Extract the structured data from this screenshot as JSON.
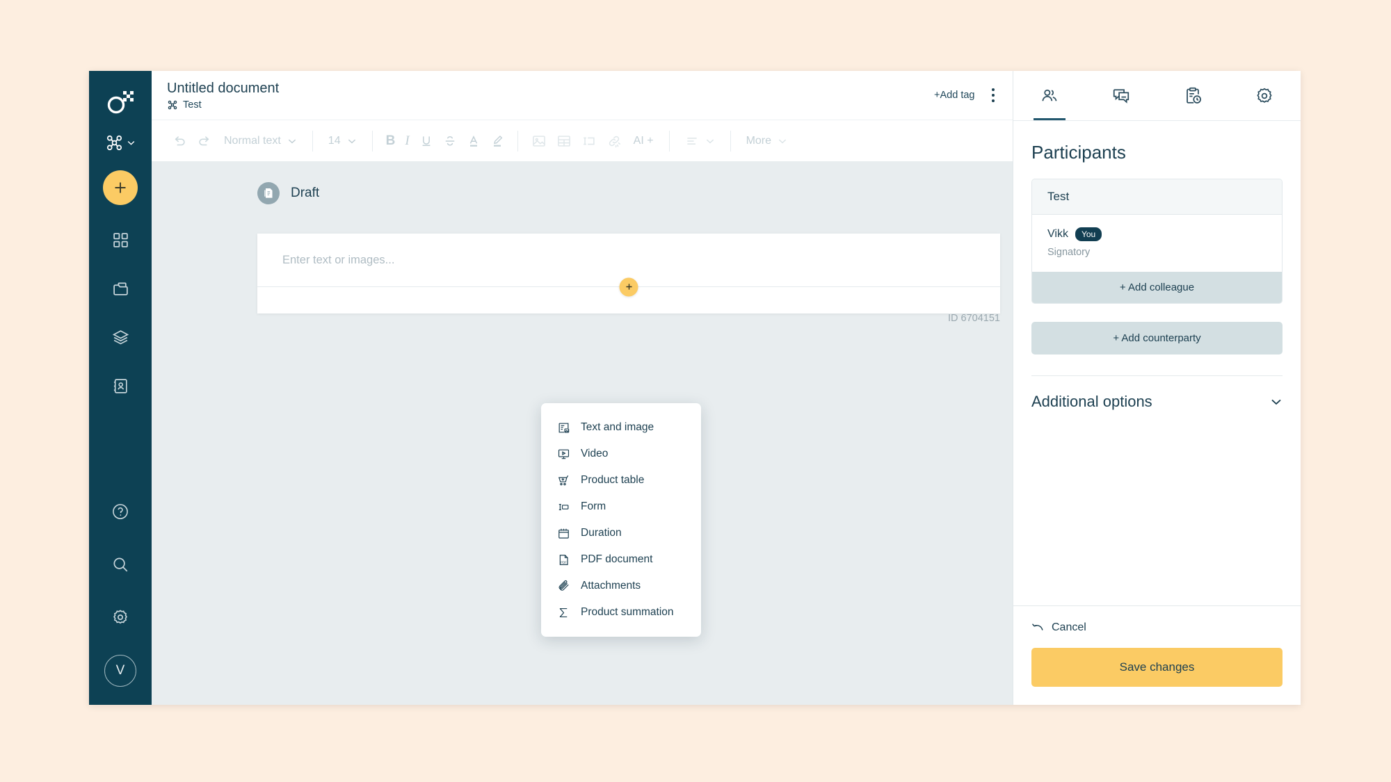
{
  "sidebar": {
    "logo_icon": "oneflow-logo-icon",
    "workspace_switcher_icon": "workspace-nodes-icon",
    "add_button_icon": "plus-icon",
    "items": [
      {
        "icon": "grid-dashboard-icon",
        "name": "dashboard"
      },
      {
        "icon": "folder-archive-icon",
        "name": "archive"
      },
      {
        "icon": "layers-templates-icon",
        "name": "templates"
      },
      {
        "icon": "contacts-book-icon",
        "name": "contacts"
      }
    ],
    "bottom_items": [
      {
        "icon": "help-circle-icon",
        "name": "help"
      },
      {
        "icon": "search-icon",
        "name": "search"
      },
      {
        "icon": "gear-icon",
        "name": "settings"
      }
    ],
    "avatar_initial": "V"
  },
  "header": {
    "title": "Untitled document",
    "workspace_icon": "workspace-nodes-icon",
    "workspace": "Test",
    "add_tag_label": "+Add tag",
    "kebab_icon": "more-vertical-icon"
  },
  "toolbar": {
    "undo_icon": "undo-icon",
    "redo_icon": "redo-icon",
    "style_label": "Normal text",
    "font_size": "14",
    "bold_label": "B",
    "italic_label": "I",
    "underline_label": "U",
    "strike_label": "S",
    "text_color_label": "A",
    "highlight_icon": "highlighter-icon",
    "image_icon": "image-icon",
    "table_icon": "table-icon",
    "field_icon": "text-field-icon",
    "link_icon": "unlink-icon",
    "ai_label": "AI +",
    "align_icon": "align-left-icon",
    "more_label": "More"
  },
  "document": {
    "status_icon": "document-draft-icon",
    "status_label": "Draft",
    "editor_placeholder": "Enter text or images...",
    "insert_plus_icon": "plus-icon",
    "id_label": "ID 6704151"
  },
  "insert_menu": {
    "items": [
      {
        "label": "Text and image",
        "icon": "text-image-icon"
      },
      {
        "label": "Video",
        "icon": "video-icon"
      },
      {
        "label": "Product table",
        "icon": "cart-plus-icon"
      },
      {
        "label": "Form",
        "icon": "form-field-icon"
      },
      {
        "label": "Duration",
        "icon": "calendar-icon"
      },
      {
        "label": "PDF document",
        "icon": "pdf-file-icon"
      },
      {
        "label": "Attachments",
        "icon": "paperclip-icon"
      },
      {
        "label": "Product summation",
        "icon": "sigma-sum-icon"
      }
    ]
  },
  "panel": {
    "tabs": [
      {
        "name": "participants",
        "icon": "people-icon",
        "active": true
      },
      {
        "name": "comments",
        "icon": "chat-bubble-icon",
        "active": false
      },
      {
        "name": "audit-trail",
        "icon": "clipboard-clock-icon",
        "active": false
      },
      {
        "name": "settings",
        "icon": "gear-icon",
        "active": false
      }
    ],
    "title": "Participants",
    "party": {
      "name": "Test",
      "person_name": "Vikk",
      "person_badge": "You",
      "person_role": "Signatory",
      "add_colleague_label": "+ Add colleague"
    },
    "add_counterparty_label": "+ Add counterparty",
    "additional_options_label": "Additional options",
    "additional_options_chevron": "chevron-down-icon",
    "cancel_label": "Cancel",
    "cancel_icon": "undo-arrow-icon",
    "save_label": "Save changes"
  },
  "colors": {
    "page_background": "#FDEEE0",
    "rail": "#0D4154",
    "accent_yellow": "#FBCB64",
    "canvas": "#E8EDEF",
    "text_dark": "#1C3F50",
    "soft_button": "#D3DFE2"
  }
}
